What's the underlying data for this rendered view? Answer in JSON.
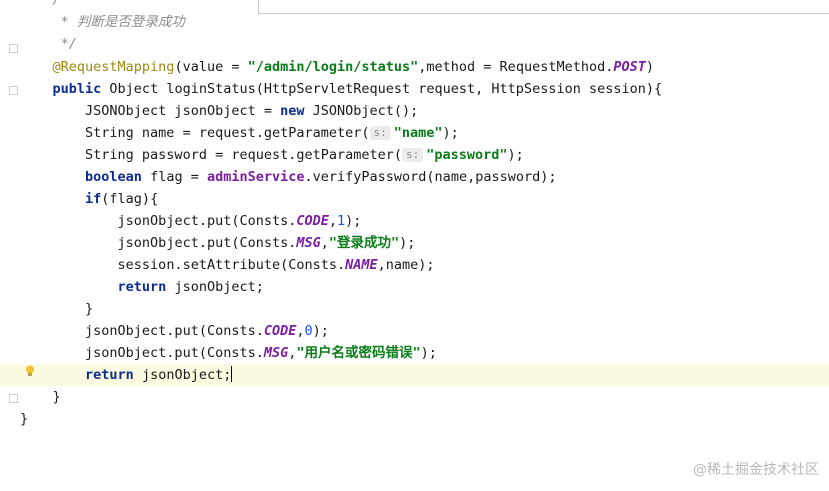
{
  "editor": {
    "lines": {
      "l01": {
        "indent": "    ",
        "comment": "/**"
      },
      "l02": {
        "indent": "     ",
        "comment": "* 判断是否登录成功"
      },
      "l03": {
        "indent": "     ",
        "comment": "*/"
      },
      "l04": {
        "indent": "    ",
        "annotation": "@RequestMapping",
        "p1": "(value = ",
        "s1": "\"/admin/login/status\"",
        "p2": ",method = RequestMethod.",
        "f1": "POST",
        "p3": ")"
      },
      "l05": {
        "indent": "    ",
        "k1": "public",
        "p1": " Object loginStatus(HttpServletRequest request, HttpSession session){"
      },
      "l06": {
        "indent": "        ",
        "p1": "JSONObject jsonObject = ",
        "k1": "new",
        "p2": " JSONObject();"
      },
      "l07": {
        "indent": "        ",
        "p1": "String name = request.getParameter(",
        "hint": "s:",
        "s1": "\"name\"",
        "p2": ");"
      },
      "l08": {
        "indent": "        ",
        "p1": "String password = request.getParameter(",
        "hint": "s:",
        "s1": "\"password\"",
        "p2": ");"
      },
      "l09": {
        "indent": "        ",
        "k1": "boolean",
        "p1": " flag = ",
        "svc": "adminService",
        "p2": ".verifyPassword(name,password);"
      },
      "l10": {
        "indent": "        ",
        "k1": "if",
        "p1": "(flag){"
      },
      "l11": {
        "indent": "            ",
        "p1": "jsonObject.put(Consts.",
        "f1": "CODE",
        "p2": ",",
        "n1": "1",
        "p3": ");"
      },
      "l12": {
        "indent": "            ",
        "p1": "jsonObject.put(Consts.",
        "f1": "MSG",
        "p2": ",",
        "s1": "\"登录成功\"",
        "p3": ");"
      },
      "l13": {
        "indent": "            ",
        "p1": "session.setAttribute(Consts.",
        "f1": "NAME",
        "p2": ",name);"
      },
      "l14": {
        "indent": "            ",
        "k1": "return",
        "p1": " jsonObject;"
      },
      "l15": {
        "indent": "        ",
        "p1": "}"
      },
      "l16": {
        "indent": "        ",
        "p1": "jsonObject.put(Consts.",
        "f1": "CODE",
        "p2": ",",
        "n1": "0",
        "p3": ");"
      },
      "l17": {
        "indent": "        ",
        "p1": "jsonObject.put(Consts.",
        "f1": "MSG",
        "p2": ",",
        "s1": "\"用户名或密码错误\"",
        "p3": ");"
      },
      "l18": {
        "indent": "        ",
        "k1": "return",
        "p1": " jsonObject;"
      },
      "l19": {
        "indent": "    ",
        "p1": "}"
      },
      "l20": {
        "indent": "",
        "p1": "}"
      }
    }
  },
  "watermark": "@稀土掘金技术社区",
  "icons": {
    "bulb": "lightbulb-icon",
    "fold": "fold-marker-icon"
  },
  "colors": {
    "keyword": "#0b2d8f",
    "string": "#0a7d18",
    "field": "#7b1fa2",
    "annotation": "#9e880d",
    "comment": "#8c8c8c",
    "current_line": "#fcfae0"
  }
}
